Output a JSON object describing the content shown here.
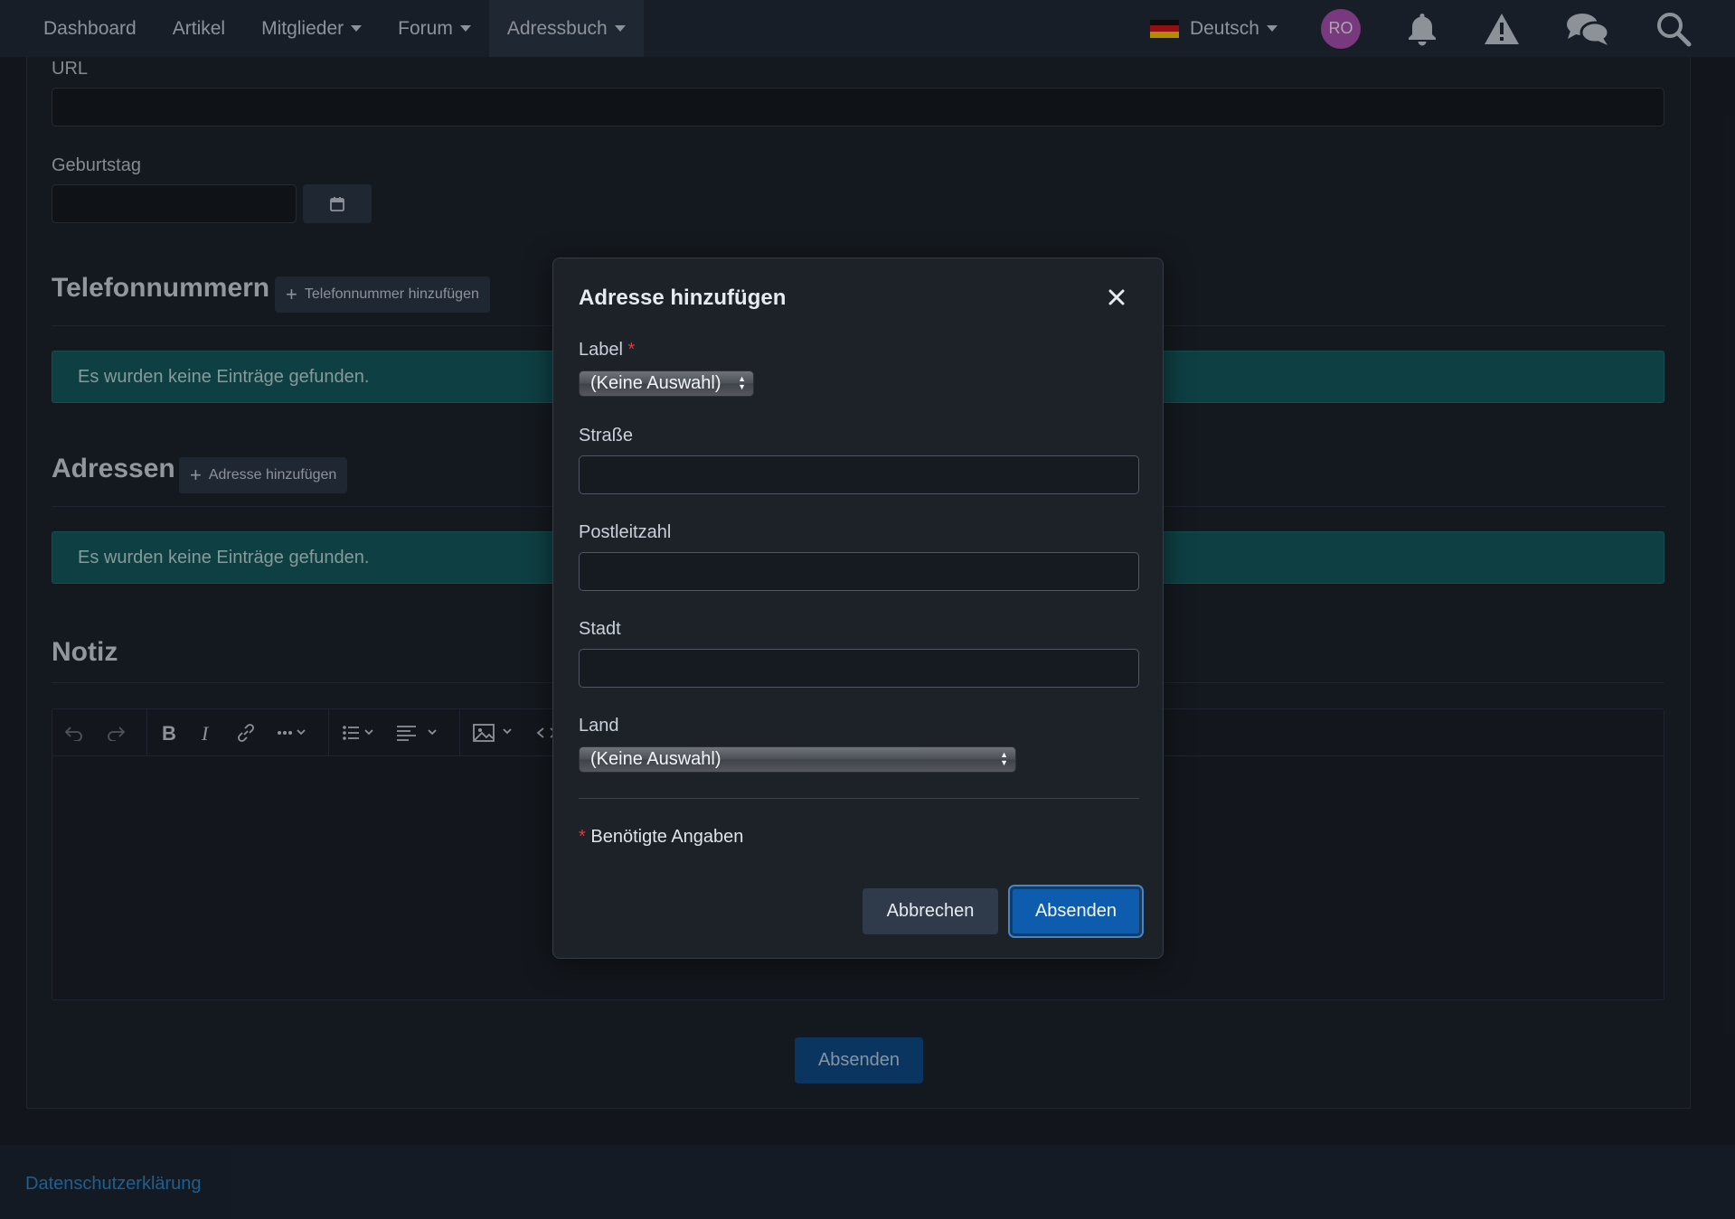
{
  "nav": {
    "items": [
      {
        "label": "Dashboard",
        "dropdown": false
      },
      {
        "label": "Artikel",
        "dropdown": false
      },
      {
        "label": "Mitglieder",
        "dropdown": true
      },
      {
        "label": "Forum",
        "dropdown": true
      },
      {
        "label": "Adressbuch",
        "dropdown": true,
        "active": true
      }
    ],
    "language": "Deutsch",
    "avatar_initials": "RO",
    "icons": [
      "bell-icon",
      "warning-icon",
      "chat-bubbles-icon",
      "search-icon"
    ]
  },
  "form": {
    "url_label": "URL",
    "url_value": "",
    "birthday_label": "Geburtstag",
    "birthday_value": ""
  },
  "phones": {
    "title": "Telefonnummern",
    "add_label": "Telefonnummer hinzufügen",
    "empty_message": "Es wurden keine Einträge gefunden."
  },
  "addresses": {
    "title": "Adressen",
    "add_label": "Adresse hinzufügen",
    "empty_message": "Es wurden keine Einträge gefunden."
  },
  "note": {
    "title": "Notiz",
    "toolbar_icons": [
      "undo-icon",
      "redo-icon",
      "bold-icon",
      "italic-icon",
      "link-icon",
      "more-icon",
      "list-icon",
      "align-icon",
      "image-icon",
      "code-icon"
    ]
  },
  "main_submit": "Absenden",
  "footer": {
    "privacy_link": "Datenschutzerklärung"
  },
  "dialog": {
    "title": "Adresse hinzufügen",
    "label_field": {
      "label": "Label",
      "required_mark": "*",
      "selected": "(Keine Auswahl)"
    },
    "street": {
      "label": "Straße",
      "value": ""
    },
    "postal": {
      "label": "Postleitzahl",
      "value": ""
    },
    "city": {
      "label": "Stadt",
      "value": ""
    },
    "country": {
      "label": "Land",
      "selected": "(Keine Auswahl)"
    },
    "required_note": {
      "mark": "*",
      "text": "Benötigte Angaben"
    },
    "cancel": "Abbrechen",
    "submit": "Absenden"
  },
  "colors": {
    "accent": "#0e5cae",
    "info_box": "#14585d",
    "avatar": "#a84fb0",
    "required": "#e0373b",
    "link": "#2b84c6"
  }
}
